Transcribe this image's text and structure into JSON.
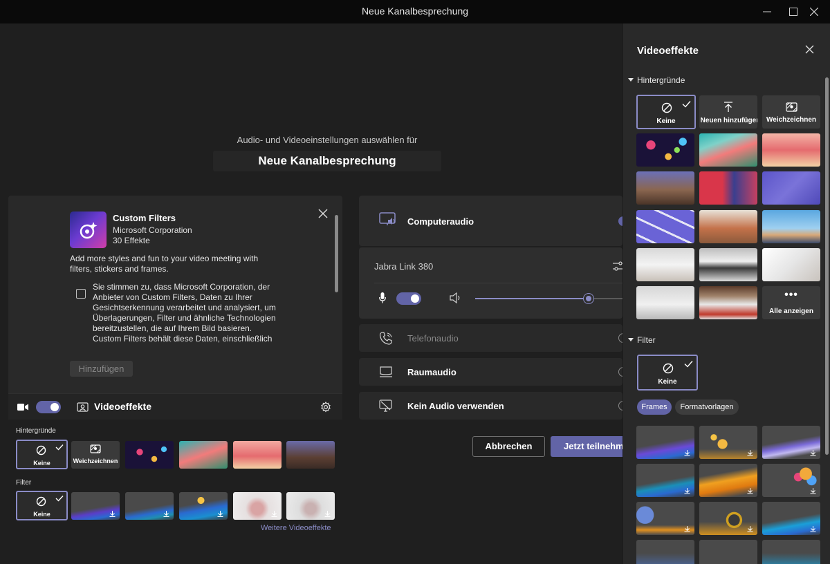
{
  "window": {
    "title": "Neue Kanalbesprechung"
  },
  "prejoin": {
    "subtitle": "Audio- und Videoeinstellungen auswählen für",
    "meeting_title": "Neue Kanalbesprechung"
  },
  "app_card": {
    "name": "Custom Filters",
    "publisher": "Microsoft Corporation",
    "effects_count": "30 Effekte",
    "description": "Add more styles and fun to your video meeting with filters, stickers and frames.",
    "consent_text": "Sie stimmen zu, dass Microsoft Corporation, der Anbieter von Custom Filters, Daten zu Ihrer Gesichtserkennung verarbeitet und analysiert, um Überlagerungen, Filter und ähnliche Technologien bereitzustellen, die auf Ihrem Bild basieren. Custom Filters behält diese Daten, einschließlich",
    "add_button": "Hinzufügen"
  },
  "video_effects_bar": {
    "label": "Videoeffekte",
    "camera_on": true,
    "backgrounds_label": "Hintergründe",
    "none_label": "Keine",
    "blur_label": "Weichzeichnen",
    "filter_label": "Filter",
    "filter_none_label": "Keine",
    "more_link": "Weitere Videoeffekte"
  },
  "audio": {
    "computer_audio": "Computeraudio",
    "device": "Jabra Link 380",
    "mic_on": true,
    "volume_percent": 73,
    "phone_audio": "Telefonaudio",
    "room_audio": "Raumaudio",
    "no_audio": "Kein Audio verwenden"
  },
  "actions": {
    "cancel": "Abbrechen",
    "join": "Jetzt teilnehmen"
  },
  "side_panel": {
    "title": "Videoeffekte",
    "backgrounds_section": "Hintergründe",
    "none_label": "Keine",
    "add_new_label": "Neuen hinzufügen",
    "blur_label": "Weichzeichnen",
    "show_all_label": "Alle anzeigen",
    "filter_section": "Filter",
    "filter_none_label": "Keine",
    "tabs": [
      "Frames",
      "Formatvorlagen"
    ]
  },
  "colors": {
    "accent": "#6264a7",
    "accent_light": "#8b8cc7",
    "background": "#1f1f1f",
    "panel": "#292929"
  }
}
